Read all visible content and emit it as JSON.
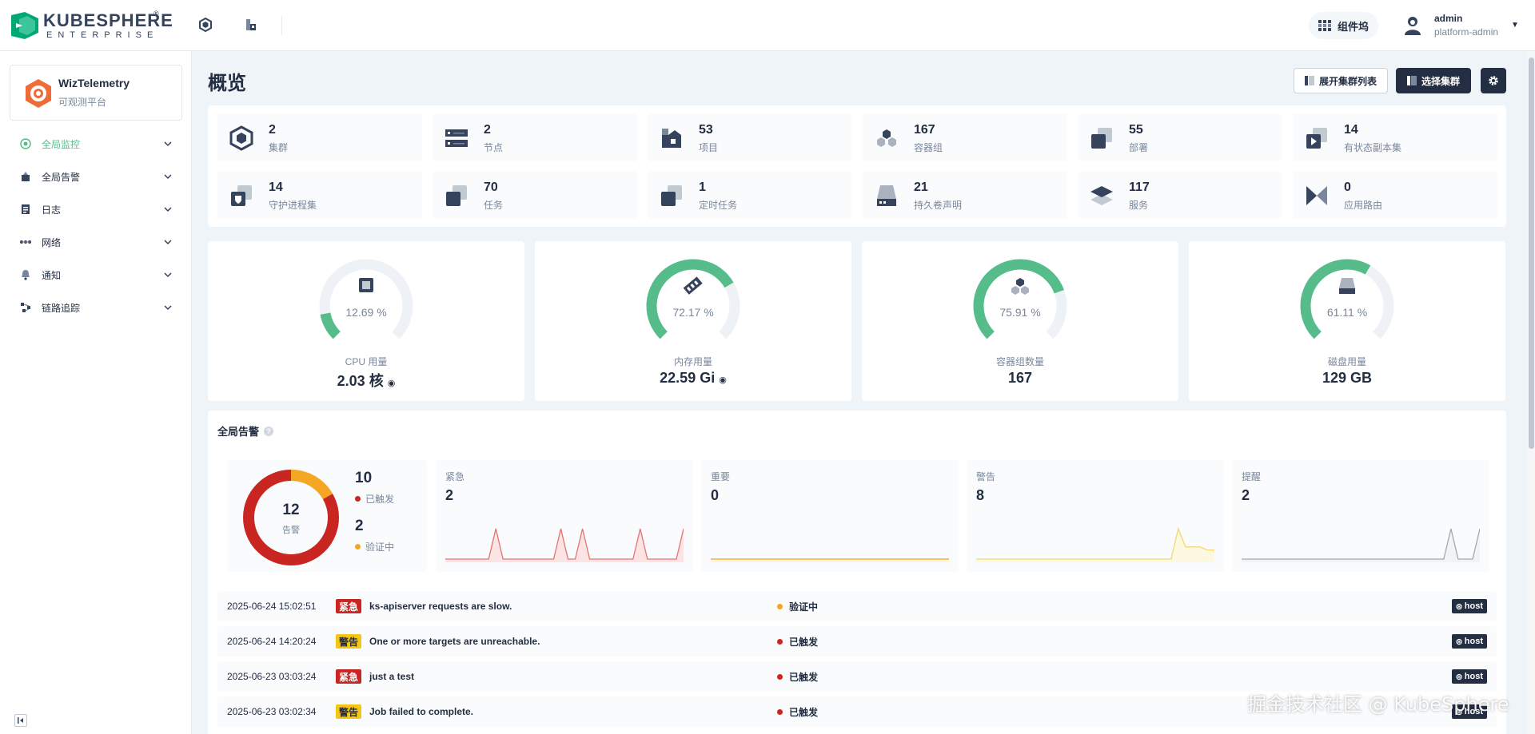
{
  "brand": {
    "name": "KUBESPHERE",
    "reg": "®",
    "sub": "ENTERPRISE"
  },
  "topbar": {
    "workspace_btn": "组件坞",
    "user": {
      "name": "admin",
      "role": "platform-admin"
    }
  },
  "sidebar": {
    "app": {
      "name": "WizTelemetry",
      "desc": "可观测平台"
    },
    "items": [
      {
        "label": "全局监控",
        "active": true
      },
      {
        "label": "全局告警"
      },
      {
        "label": "日志"
      },
      {
        "label": "网络"
      },
      {
        "label": "通知"
      },
      {
        "label": "链路追踪"
      }
    ]
  },
  "page": {
    "title": "概览",
    "expand_btn": "展开集群列表",
    "select_btn": "选择集群"
  },
  "resources": [
    {
      "count": "2",
      "label": "集群",
      "icon": "cluster-icon"
    },
    {
      "count": "2",
      "label": "节点",
      "icon": "node-icon"
    },
    {
      "count": "53",
      "label": "项目",
      "icon": "project-icon"
    },
    {
      "count": "167",
      "label": "容器组",
      "icon": "pod-icon"
    },
    {
      "count": "55",
      "label": "部署",
      "icon": "deployment-icon"
    },
    {
      "count": "14",
      "label": "有状态副本集",
      "icon": "statefulset-icon"
    },
    {
      "count": "14",
      "label": "守护进程集",
      "icon": "daemonset-icon"
    },
    {
      "count": "70",
      "label": "任务",
      "icon": "job-icon"
    },
    {
      "count": "1",
      "label": "定时任务",
      "icon": "cronjob-icon"
    },
    {
      "count": "21",
      "label": "持久卷声明",
      "icon": "pvc-icon"
    },
    {
      "count": "117",
      "label": "服务",
      "icon": "service-icon"
    },
    {
      "count": "0",
      "label": "应用路由",
      "icon": "ingress-icon"
    }
  ],
  "gauges": [
    {
      "pct": 12.69,
      "pct_text": "12.69 %",
      "label": "CPU 用量",
      "value": "2.03 核",
      "icon": "cpu-icon"
    },
    {
      "pct": 72.17,
      "pct_text": "72.17 %",
      "label": "内存用量",
      "value": "22.59 Gi",
      "icon": "memory-icon"
    },
    {
      "pct": 75.91,
      "pct_text": "75.91 %",
      "label": "容器组数量",
      "value": "167",
      "icon": "pod-icon"
    },
    {
      "pct": 61.11,
      "pct_text": "61.11 %",
      "label": "磁盘用量",
      "value": "129 GB",
      "icon": "disk-icon"
    }
  ],
  "colors": {
    "accent": "#55bc8a",
    "track": "#eef2f6",
    "critical": "#ca2621",
    "warning": "#f5a623",
    "info": "#f5c414"
  },
  "alerts": {
    "title": "全局告警",
    "total": "12",
    "total_label": "告警",
    "firing": {
      "count": 10,
      "label": "已触发"
    },
    "pending": {
      "count": 2,
      "label": "验证中"
    },
    "severities": [
      {
        "name": "紧急",
        "count": "2",
        "color": "#e57373",
        "fill": "#fbe4e3",
        "series": [
          0,
          0,
          0,
          0,
          0,
          0,
          0,
          1,
          0,
          0,
          0,
          0,
          0,
          0,
          0,
          0,
          1,
          0,
          0,
          1,
          0,
          0,
          0,
          0,
          0,
          0,
          0,
          1,
          0,
          0,
          0,
          0,
          0,
          1
        ]
      },
      {
        "name": "重要",
        "count": "0",
        "color": "#f5a623",
        "fill": "#fdf4e3",
        "series": [
          0,
          0,
          0,
          0,
          0,
          0,
          0,
          0,
          0,
          0,
          0,
          0,
          0,
          0,
          0,
          0,
          0,
          0,
          0,
          0,
          0,
          0,
          0,
          0,
          0,
          0,
          0,
          0,
          0,
          0,
          0,
          0,
          0,
          0
        ]
      },
      {
        "name": "警告",
        "count": "8",
        "color": "#f5d76e",
        "fill": "#fdf8e1",
        "series": [
          0,
          0,
          0,
          0,
          0,
          0,
          0,
          0,
          0,
          0,
          0,
          0,
          0,
          0,
          0,
          0,
          0,
          0,
          0,
          0,
          0,
          0,
          0,
          0,
          0,
          0,
          0,
          0,
          1,
          0.4,
          0.4,
          0.4,
          0.3,
          0.3
        ]
      },
      {
        "name": "提醒",
        "count": "2",
        "color": "#a0a9b4",
        "fill": "#f1f3f5",
        "series": [
          0,
          0,
          0,
          0,
          0,
          0,
          0,
          0,
          0,
          0,
          0,
          0,
          0,
          0,
          0,
          0,
          0,
          0,
          0,
          0,
          0,
          0,
          0,
          0,
          0,
          0,
          0,
          0,
          0,
          1,
          0,
          0,
          0,
          1
        ]
      }
    ],
    "rows": [
      {
        "time": "2025-06-24 15:02:51",
        "level": "紧急",
        "type": "crit",
        "msg": "ks-apiserver requests are slow.",
        "state": "验证中",
        "state_color": "#f5a623",
        "cluster": "host"
      },
      {
        "time": "2025-06-24 14:20:24",
        "level": "警告",
        "type": "warn",
        "msg": "One or more targets are unreachable.",
        "state": "已触发",
        "state_color": "#ca2621",
        "cluster": "host"
      },
      {
        "time": "2025-06-23 03:03:24",
        "level": "紧急",
        "type": "crit",
        "msg": "just a test",
        "state": "已触发",
        "state_color": "#ca2621",
        "cluster": "host"
      },
      {
        "time": "2025-06-23 03:02:34",
        "level": "警告",
        "type": "warn",
        "msg": "Job failed to complete.",
        "state": "已触发",
        "state_color": "#ca2621",
        "cluster": "host"
      }
    ]
  },
  "watermark": "掘金技术社区 @ KubeSphere"
}
